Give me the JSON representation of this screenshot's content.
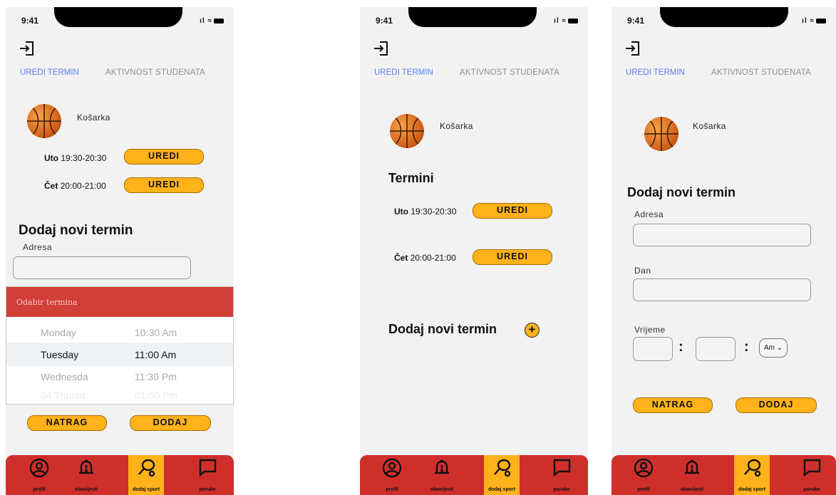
{
  "status": {
    "time": "9:41"
  },
  "tabs": {
    "edit": "UREDI TERMIN",
    "activity": "AKTIVNOST STUDENATA"
  },
  "sport": {
    "name": "Košarka"
  },
  "slots": [
    {
      "prefix": "Uto",
      "time": "19:30-20:30"
    },
    {
      "prefix": "Čet",
      "time": "20:00-21:00"
    }
  ],
  "buttons": {
    "edit": "UREDI",
    "back": "NATRAG",
    "add": "DODAJ"
  },
  "form": {
    "title": "Dodaj novi termin",
    "address_label": "Adresa",
    "day_label": "Dan",
    "time_label": "Vrijeme",
    "ampm_value": "Am"
  },
  "picker": {
    "title": "Odabir termina",
    "rows": [
      {
        "day": "Monday",
        "time": "10:30 Am"
      },
      {
        "day": "Tuesday",
        "time": "11:00 Am"
      },
      {
        "day": "Wednesda",
        "time": "11:30 Pm"
      },
      {
        "day": "04 Thursd",
        "time": "01:00 Pm"
      }
    ]
  },
  "screen2": {
    "section_title": "Termini"
  },
  "nav": {
    "profile": "profil",
    "notifications": "obavijesti",
    "add_sport": "dodaj sport",
    "messages": "poruke"
  },
  "colors": {
    "accent": "#ffb21a",
    "brand_red": "#cf2f2b",
    "tab_active": "#5b7cf6"
  }
}
